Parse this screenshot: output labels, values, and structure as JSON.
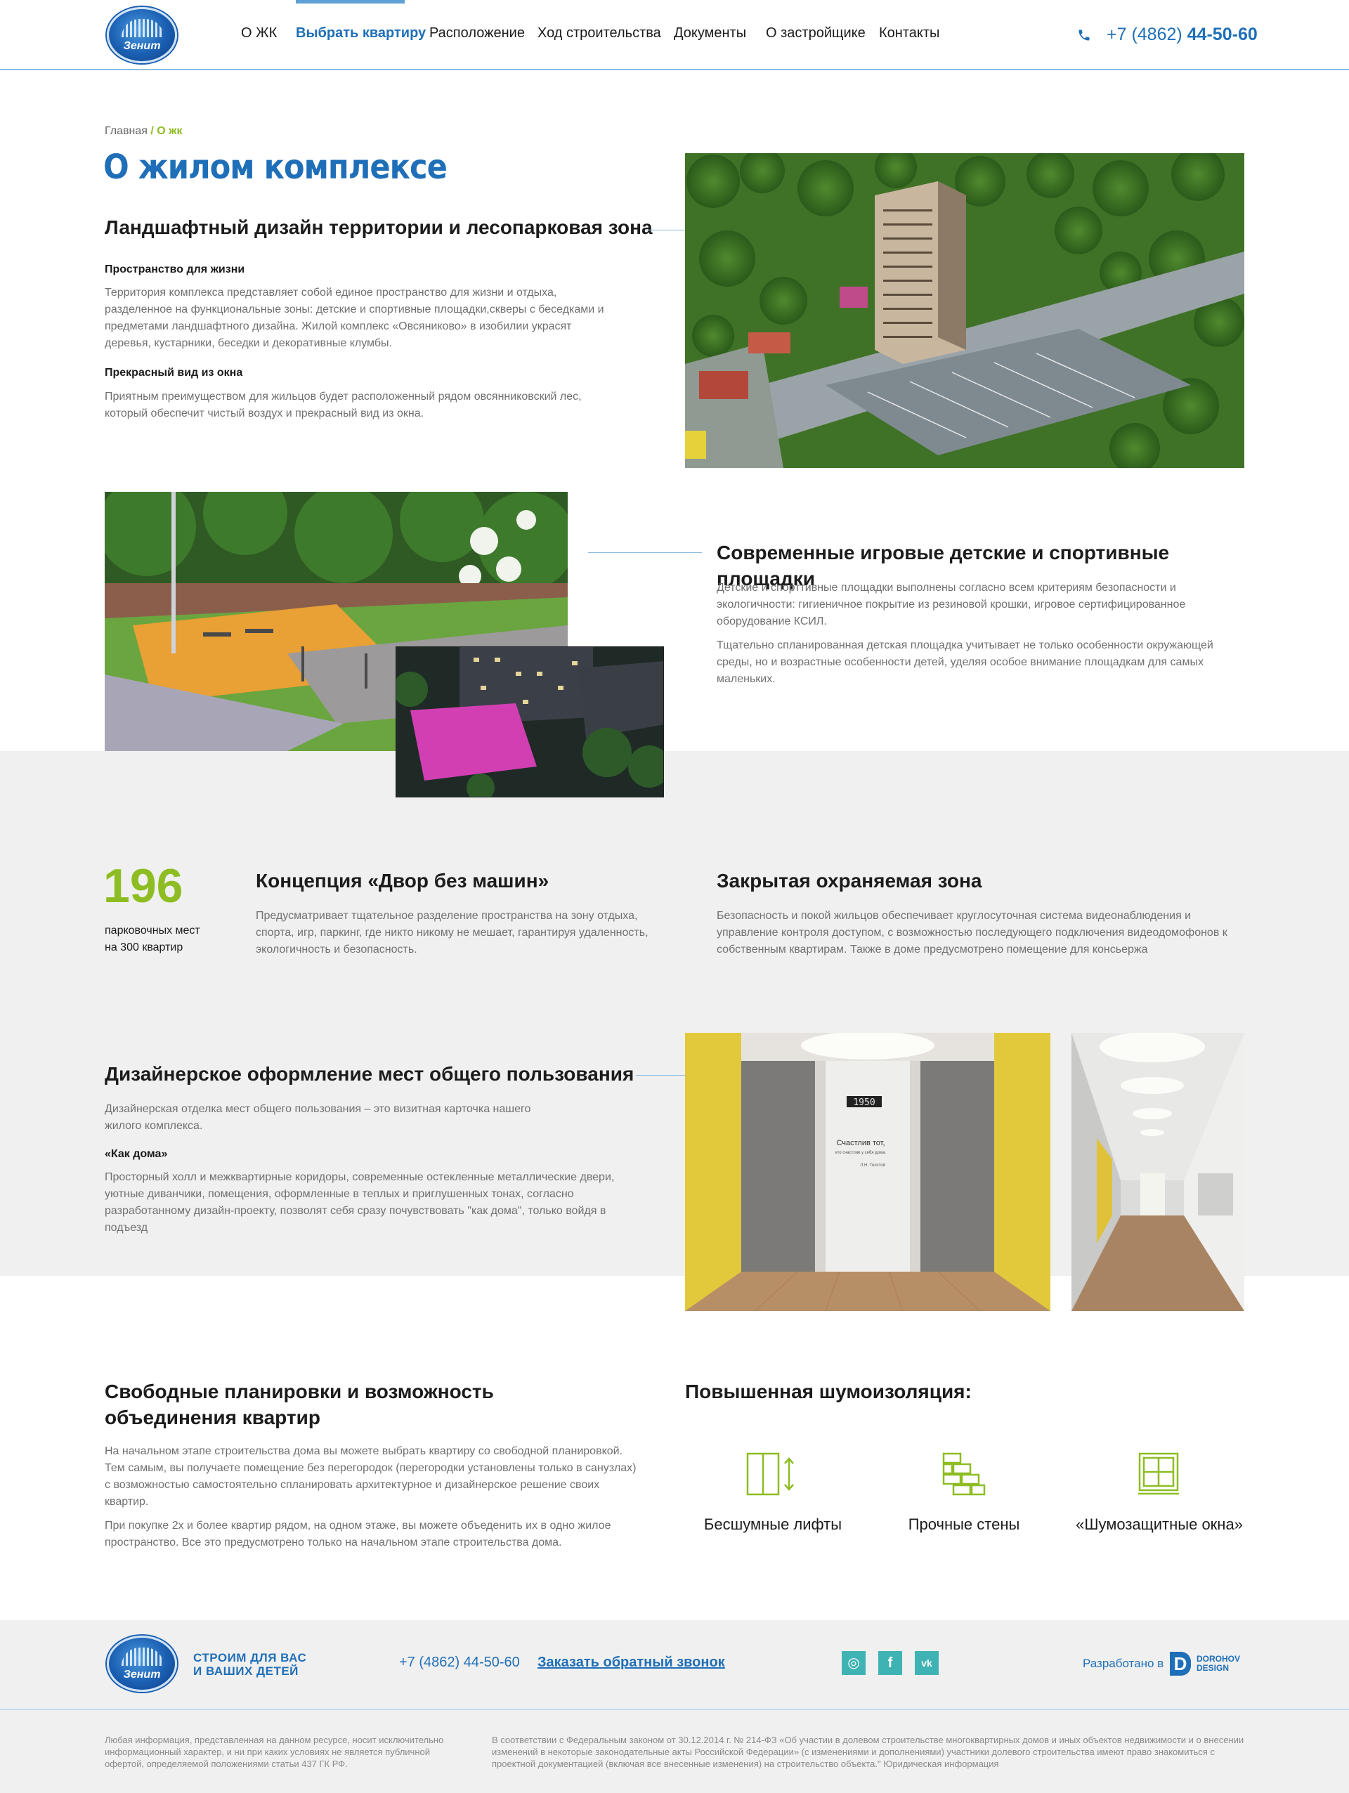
{
  "header": {
    "logo_text": "Зенит",
    "nav": [
      {
        "label": "О ЖК"
      },
      {
        "label": "Выбрать квартиру"
      },
      {
        "label": "Расположение"
      },
      {
        "label": "Ход строительства"
      },
      {
        "label": "Документы"
      },
      {
        "label": "О застройщике"
      },
      {
        "label": "Контакты"
      }
    ],
    "active_nav": "Выбрать квартиру",
    "phone_prefix": "+7 (4862)",
    "phone_number": "44-50-60"
  },
  "breadcrumb": {
    "home": "Главная",
    "separator": "/",
    "current": "О жк"
  },
  "page_title": "О жилом комплексе",
  "landscape": {
    "title": "Ландшафтный дизайн территории и лесопарковая зона",
    "sub1_title": "Пространство для жизни",
    "sub1_text": "Территория комплекса представляет собой единое пространство для жизни и отдыха, разделенное на функциональные зоны: детские и спортивные площадки,скверы с беседками и предметами ландшафтного дизайна. Жилой комплекс «Овсяниково» в изобилии украсят деревья, кустарники, беседки и декоративные клумбы.",
    "sub2_title": "Прекрасный вид из окна",
    "sub2_text": "Приятным преимуществом для жильцов будет расположенный рядом овсянниковский лес, который обеспечит чистый воздух и прекрасный вид из окна."
  },
  "playground": {
    "title": "Современные игровые детские и спортивные площадки",
    "text1": "Детские и спорттивные площадки выполнены согласно всем критериям безопасности и экологичности: гигиеничное покрытие из резиновой крошки, игровое сертифицированное оборудование КСИЛ.",
    "text2": "Тщательно спланированная детская площадка учитывает не только особенности окружающей среды, но и возрастные особенности детей, уделяя особое внимание площадкам для самых маленьких."
  },
  "parking": {
    "number": "196",
    "caption_line1": "парковочных мест",
    "caption_line2": "на 300 квартир",
    "title": "Концепция «Двор без машин»",
    "text": "Предусматривает тщательное разделение пространства на зону отдыха, спорта, игр, паркинг, где никто никому не мешает, гарантируя удаленность, экологичность и безопасность."
  },
  "security": {
    "title": "Закрытая охраняемая зона",
    "text": "Безопасность и покой жильцов обеспечивает круглосуточная система видеонаблюдения и управление контроля доступом, с возможностью последующего подключения видеодомофонов к собственным квартирам. Также в доме предусмотрено помещение для консьержа"
  },
  "design": {
    "title": "Дизайнерское оформление мест общего пользования",
    "text1": "Дизайнерская отделка мест общего пользования – это визитная карточка нашего жилого комплекса.",
    "sub_title": "«Как дома»",
    "text2": "Просторный холл и межквартирные коридоры, современные остекленные металлические двери, уютные диванчики, помещения, оформленные в теплых и приглушенных тонах, согласно разработанному дизайн-проекту, позволят себя сразу почувствовать \"как дома\", только войдя в подъезд",
    "lobby_sign_number": "1950",
    "lobby_quote_line1": "Счастлив тот,",
    "lobby_quote_line2": "кто счастлив у себя дома.",
    "lobby_quote_author": "Л.Н. Толстой"
  },
  "layouts": {
    "title_line1": "Свободные планировки и возможность",
    "title_line2": "объединения квартир",
    "text1": "На начальном этапе строительства дома вы можете выбрать квартиру со свободной планировкой. Тем самым, вы получаете помещение без перегородок (перегородки установлены только в санузлах) с возможностью  самостоятельно спланировать архитектурное и дизайнерское решение своих квартир.",
    "text2": "При покупке 2х и более квартир рядом, на одном этаже, вы можете объеденить их в одно жилое пространство. Все это предусмотрено только на начальном этапе строительства дома."
  },
  "noise": {
    "title": "Повышенная шумоизоляция:",
    "items": [
      {
        "icon": "elevator-icon",
        "label": "Бесшумные лифты"
      },
      {
        "icon": "brick-wall-icon",
        "label": "Прочные стены"
      },
      {
        "icon": "window-icon",
        "label": "«Шумозащитные окна»"
      }
    ]
  },
  "footer": {
    "logo_text": "Зенит",
    "slogan_line1": "СТРОИМ ДЛЯ ВАС",
    "slogan_line2": "И ВАШИХ ДЕТЕЙ",
    "phone": "+7 (4862) 44-50-60",
    "callback": "Заказать обратный звонок",
    "social": [
      {
        "icon": "instagram-icon",
        "glyph": "◎"
      },
      {
        "icon": "facebook-icon",
        "glyph": "f"
      },
      {
        "icon": "vk-icon",
        "glyph": "vk"
      }
    ],
    "developed_by": "Разработано в",
    "dev_logo_letter": "D",
    "dev_logo_line1": "DOROHOV",
    "dev_logo_line2": "DESIGN",
    "disclaimer_left": "Любая информация, представленная на данном ресурсе, носит исключительно информационный характер, и ни при каких условиях не является публичной офертой, определяемой положениями статьи 437 ГК РФ.",
    "disclaimer_right": "В соответствии с Федеральным законом от 30.12.2014 г. № 214-ФЗ «Об участии в долевом строительстве многоквартирных домов и иных объектов недвижимости и о внесении изменений в некоторые законодательные акты Российской Федерации» (с изменениями и дополнениями) участники долевого строительства имеют право знакомиться с проектной документацией (включая все внесенные изменения) на строительство объекта.\" Юридическая информация"
  },
  "colors": {
    "brand_blue": "#1f6fb8",
    "accent_green": "#8dbd22",
    "gray_bg": "#f0f0f0"
  }
}
